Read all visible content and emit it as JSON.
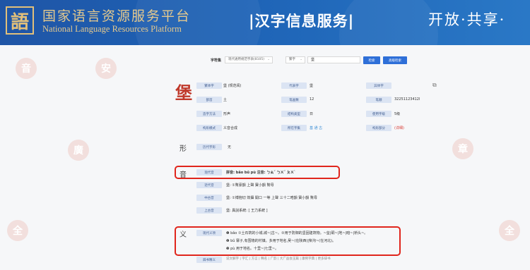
{
  "header": {
    "logo_glyph": "語",
    "name_cn": "国家语言资源服务平台",
    "name_en": "National Language Resources Platform",
    "service_title": "|汉字信息服务|",
    "slogan": "开放·共享·"
  },
  "watermark_seals": [
    "音",
    "安",
    "廣",
    "全",
    "全",
    "章"
  ],
  "search": {
    "label": "字符集",
    "charset_value": "现代通用规范字表(8105)",
    "mode_value": "繁字",
    "query": "堡",
    "search_button": "检索",
    "advanced_button": "高级检索"
  },
  "character": {
    "glyph": "堡",
    "copy_icon": "copy-icon"
  },
  "info": {
    "rows": [
      [
        {
          "label": "繁体字",
          "value": "堡 (规范阅)"
        },
        {
          "label": "代表字",
          "value": "堡"
        },
        {
          "label": "异体字",
          "value": ""
        }
      ],
      [
        {
          "label": "部首",
          "value": "土"
        },
        {
          "label": "笔画数",
          "value": "12"
        },
        {
          "label": "笔顺",
          "value": "32251123412l"
        }
      ],
      [
        {
          "label": "造字方法",
          "value": "形声"
        },
        {
          "label": "结构类型",
          "value": "日"
        },
        {
          "label": "使用字级",
          "value": "5级"
        }
      ],
      [
        {
          "label": "构形模式",
          "value": "义音合成"
        },
        {
          "label": "所在字集",
          "value": "基 通 古"
        },
        {
          "label": "构形部分",
          "value": "(详细)"
        }
      ]
    ]
  },
  "sections": {
    "xing": {
      "title": "形",
      "label": "历代字形",
      "value": "无"
    },
    "yin": {
      "title": "音",
      "rows": [
        {
          "label": "现代音",
          "value": "拼音: bǎo  bǔ  pù          注音: ㄅㄠˇ   ㄅㄨˇ   ㄆㄨˋ"
        },
        {
          "label": "近代音",
          "value": "堡: ①幫豪韻 上聲 寶小韻 幫母"
        },
        {
          "label": "中古音",
          "value": "堡: ①博抱切 效攝 開口 一等 上聲 三十二晧韻 寶小韻 幫母"
        },
        {
          "label": "上古音",
          "value": "堡: 異說系統: [ 王力系統 ]"
        }
      ]
    },
    "yi": {
      "title": "义",
      "label": "现代义项",
      "lines": [
        "❶ bǎo ①土石筑的小城,城~|古~。②用于防御的坚固建筑物。~垒|碉~|地~|暗~|桥头~。",
        "❷ bǔ 寨子,有围墙的村镇。多用于地名,吴~(在陕西)|柴沟~(在河北)。",
        "❸ pù 用于地名。十里~|七里~。"
      ]
    },
    "dict": {
      "label": "辞书释义",
      "value": "说文解字 | 字汇 | 方言 | 释名 | 广韵 | 大广益会玉篇 | 康熙字典 | 更多辞书"
    }
  },
  "colors": {
    "header_bg": "#1f55a6",
    "accent": "#2e6fd8",
    "highlight": "#e0251c",
    "label_bg": "#dbe4f3"
  }
}
